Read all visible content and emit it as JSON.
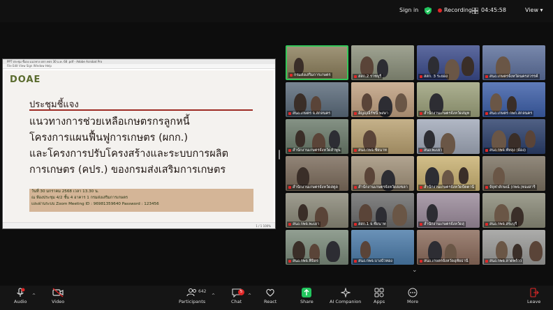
{
  "topbar": {
    "signin": "Sign in",
    "recording": "Recording",
    "timer": "04:45:58",
    "view": "View"
  },
  "share": {
    "window_title": "PPT ประชุม ชี้แจง แนวทาง ผกก คปร 30 ม.ค. 68 .pdf - Adobe Acrobat Pro",
    "menu": "File  Edit  View  Sign  Window  Help",
    "logo": "DOAE",
    "heading": "ประชุมชี้แจง",
    "lines": [
      "แนวทางการช่วยเหลือเกษตรกรลูกหนี้",
      "โครงการแผนฟื้นฟูการเกษตร (ผกก.)",
      "และโครงการปรับโครงสร้างและระบบการผลิต",
      "การเกษตร (คปร.) ของกรมส่งเสริมการเกษตร"
    ],
    "info": [
      "วันที่ 30 มกราคม 2568 เวลา 13.30 น.",
      "ณ ห้องประชุม 4/2 ชั้น 4 อาคาร 1 กรมส่งเสริมการเกษตร",
      "และผ่านระบบ Zoom Meeting ID : 96981359640 Password : 123456"
    ],
    "status": "1 / 1    100%"
  },
  "gallery": [
    {
      "label": "กรมส่งเสริมการเกษตร",
      "bg": "#8a7d5a",
      "active": true
    },
    {
      "label": "สสก.2 ราชบุรี",
      "bg": "#8a8f7a",
      "active": false
    },
    {
      "label": "สสก. 3 ระยอง",
      "bg": "#3a4a8a",
      "active": false
    },
    {
      "label": "สนง.เกษตรจังหวัดนครสวรรค์",
      "bg": "#5b6e9a",
      "active": false
    },
    {
      "label": "สนง.เกษตร จ.สกลนคร",
      "bg": "#5a6a7a",
      "active": false
    },
    {
      "label": "อัญญุณีรัชนี พงษา",
      "bg": "#c0a080",
      "active": false
    },
    {
      "label": "สำนักงานเกษตรจังหวัดสมุท",
      "bg": "#9ba07a",
      "active": false
    },
    {
      "label": "สนง.เกษตร กพก.สกลนคร",
      "bg": "#3c5ea8",
      "active": false
    },
    {
      "label": "สำนักงานเกษตรจังหวัดลำพูน",
      "bg": "#6a7a6a",
      "active": false
    },
    {
      "label": "สนง.กพจ.ชัยนาท",
      "bg": "#b8a070",
      "active": false
    },
    {
      "label": "สนง.พะเยา",
      "bg": "#a0a8b8",
      "active": false
    },
    {
      "label": "สนง.กพจ.พัทลุง (ผ้อง)",
      "bg": "#2a3e6a",
      "active": false
    },
    {
      "label": "สำนักงานเกษตรจังหวัดสตูล",
      "bg": "#7a6a5a",
      "active": false
    },
    {
      "label": "สำนักงานเกษตรจังหวัดสงขลา",
      "bg": "#a09078",
      "active": false
    },
    {
      "label": "สำนักงานเกษตรจังหวัดปัตตานี",
      "bg": "#c8b070",
      "active": false
    },
    {
      "label": "จัจุฬาลักษณ์ (กพจ.)ทองสาริ",
      "bg": "#7a7060",
      "active": false
    },
    {
      "label": "สนง.กพจ.พะเยา",
      "bg": "#8a8878",
      "active": false
    },
    {
      "label": "สสก.1 จ.ชัยนาท",
      "bg": "#6a6a6a",
      "active": false
    },
    {
      "label": "สำนักงานเกษตรจังหวัดสุ",
      "bg": "#9a8a9a",
      "active": false
    },
    {
      "label": "สนง.กพจ.สระบุรี",
      "bg": "#8a8a78",
      "active": false
    },
    {
      "label": "สนง.กพจ.ทีจิตร",
      "bg": "#7a8a7a",
      "active": false
    },
    {
      "label": "สนง.กพจ.บางบัวทอง",
      "bg": "#4a7aa8",
      "active": false
    },
    {
      "label": "สนง.เกษตรจังหวัดอุทัยธานี",
      "bg": "#8a6a5a",
      "active": false
    },
    {
      "label": "สนง.กพจ.ลาดพร้าว",
      "bg": "#9a9a98",
      "active": false
    }
  ],
  "toolbar": {
    "audio": "Audio",
    "video": "Video",
    "participants": "Participants",
    "participants_count": "642",
    "chat": "Chat",
    "chat_badge": "5",
    "react": "React",
    "share": "Share",
    "ai": "AI Companion",
    "apps": "Apps",
    "more": "More",
    "leave": "Leave"
  },
  "colors": {
    "accent_red": "#9d2a23",
    "recording": "#e02828",
    "share_green": "#22c55e",
    "active_border": "#34c759"
  }
}
